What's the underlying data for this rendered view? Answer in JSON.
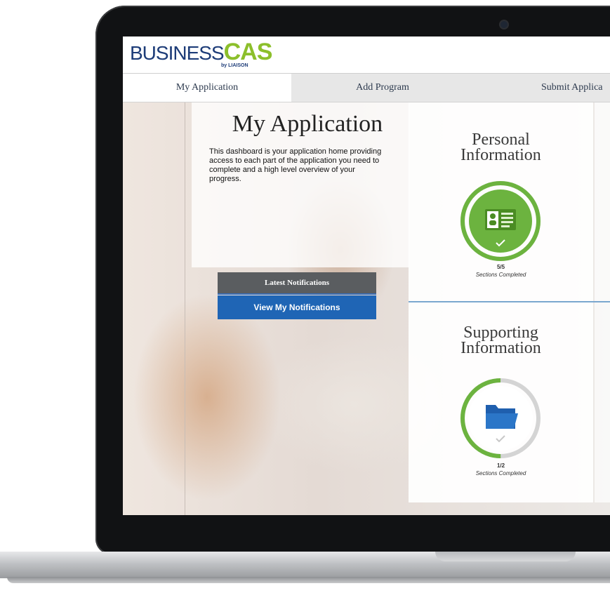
{
  "header": {
    "logo_main": "BUSINESS",
    "logo_cas": "CAS",
    "logo_sub": "by LIAISON"
  },
  "tabs": [
    {
      "label": "My Application"
    },
    {
      "label": "Add Program"
    },
    {
      "label": "Submit Applica"
    }
  ],
  "intro": {
    "title": "My Application",
    "description": "This dashboard is your application home providing access to each part of the application you need to complete and a high level overview of your progress."
  },
  "notifications": {
    "heading": "Latest Notifications",
    "button_label": "View My Notifications"
  },
  "cards": [
    {
      "title_line1": "Personal",
      "title_line2": "Information",
      "count": "5/5",
      "status": "Sections Completed",
      "progress": 1.0,
      "icon": "id-card-icon"
    },
    {
      "title_line1": "Supporting",
      "title_line2": "Information",
      "count": "1/2",
      "status": "Sections Completed",
      "progress": 0.5,
      "icon": "folder-icon"
    }
  ],
  "colors": {
    "accent_green": "#6cb33f",
    "button_blue": "#1f65b5",
    "brand_navy": "#1d3c78",
    "brand_green": "#8cbf2b"
  }
}
